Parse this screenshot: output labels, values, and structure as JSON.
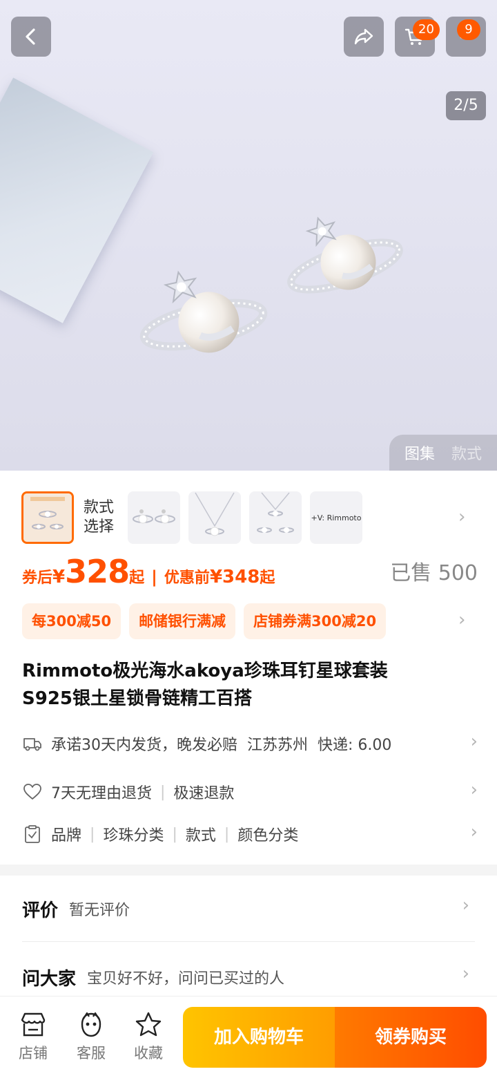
{
  "image_counter": "2/5",
  "badges": {
    "cart_count": "20",
    "message_count": "9"
  },
  "gallery_switch": {
    "active": "图集",
    "inactive": "款式"
  },
  "variants": {
    "label_line1": "款式",
    "label_line2": "选择",
    "text_thumb": "+V: Rimmoto"
  },
  "price": {
    "after_coupon_label": "券后",
    "currency": "¥",
    "amount": "328",
    "suffix": "起",
    "before_label": "优惠前",
    "before_amount": "¥348",
    "before_suffix": "起",
    "sold": "已售 500"
  },
  "promotions": [
    "每300减50",
    "邮储银行满减",
    "店铺券满300减20"
  ],
  "title_line1": "Rimmoto极光海水akoya珍珠耳钉星球套装",
  "title_line2": "S925银土星锁骨链精工百搭",
  "shipping": {
    "promise": "承诺30天内发货，晚发必赔",
    "location": "江苏苏州",
    "express": "快递: 6.00"
  },
  "returns": {
    "a": "7天无理由退货",
    "b": "极速退款"
  },
  "params": [
    "品牌",
    "珍珠分类",
    "款式",
    "颜色分类"
  ],
  "reviews": {
    "heading": "评价",
    "text": "暂无评价"
  },
  "qa": {
    "heading": "问大家",
    "text": "宝贝好不好，问问已买过的人"
  },
  "bottom_tabs": {
    "store": "店铺",
    "service": "客服",
    "favorite": "收藏"
  },
  "actions": {
    "add_to_cart": "加入购物车",
    "buy": "领券购买"
  },
  "colors": {
    "accent": "#ff5000",
    "cart_gradient": "#ffc400",
    "buy_gradient": "#ff4d00"
  }
}
